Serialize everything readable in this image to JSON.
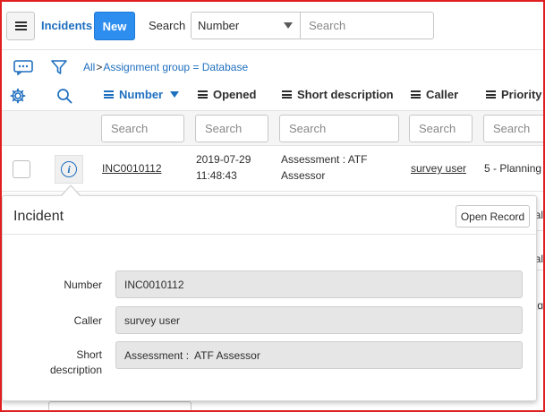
{
  "header": {
    "title": "Incidents",
    "new_label": "New",
    "search_label": "Search",
    "field_select": "Number",
    "search_placeholder": "Search"
  },
  "breadcrumb": {
    "all": "All",
    "separator": ">",
    "filter": "Assignment group = Database"
  },
  "columns": [
    {
      "label": "Number"
    },
    {
      "label": "Opened"
    },
    {
      "label": "Short description"
    },
    {
      "label": "Caller"
    },
    {
      "label": "Priority"
    }
  ],
  "filter_placeholder": "Search",
  "row": {
    "number": "INC0010112",
    "opened_date": "2019-07-29",
    "opened_time": "11:48:43",
    "short_desc_line1": "Assessment : ATF",
    "short_desc_line2": "Assessor",
    "caller": "survey user",
    "priority": "5 - Planning"
  },
  "peek": [
    "al",
    "al",
    "g"
  ],
  "popover": {
    "title": "Incident",
    "open_record": "Open Record",
    "fields": [
      {
        "label": "Number",
        "value": "INC0010112"
      },
      {
        "label": "Caller",
        "value": "survey user"
      },
      {
        "label_line1": "Short",
        "label_line2": "description",
        "value": "Assessment :  ATF Assessor"
      }
    ]
  },
  "colors": {
    "accent": "#1f6fbf",
    "new_button": "#2e8ef0",
    "frame": "#e02020"
  }
}
